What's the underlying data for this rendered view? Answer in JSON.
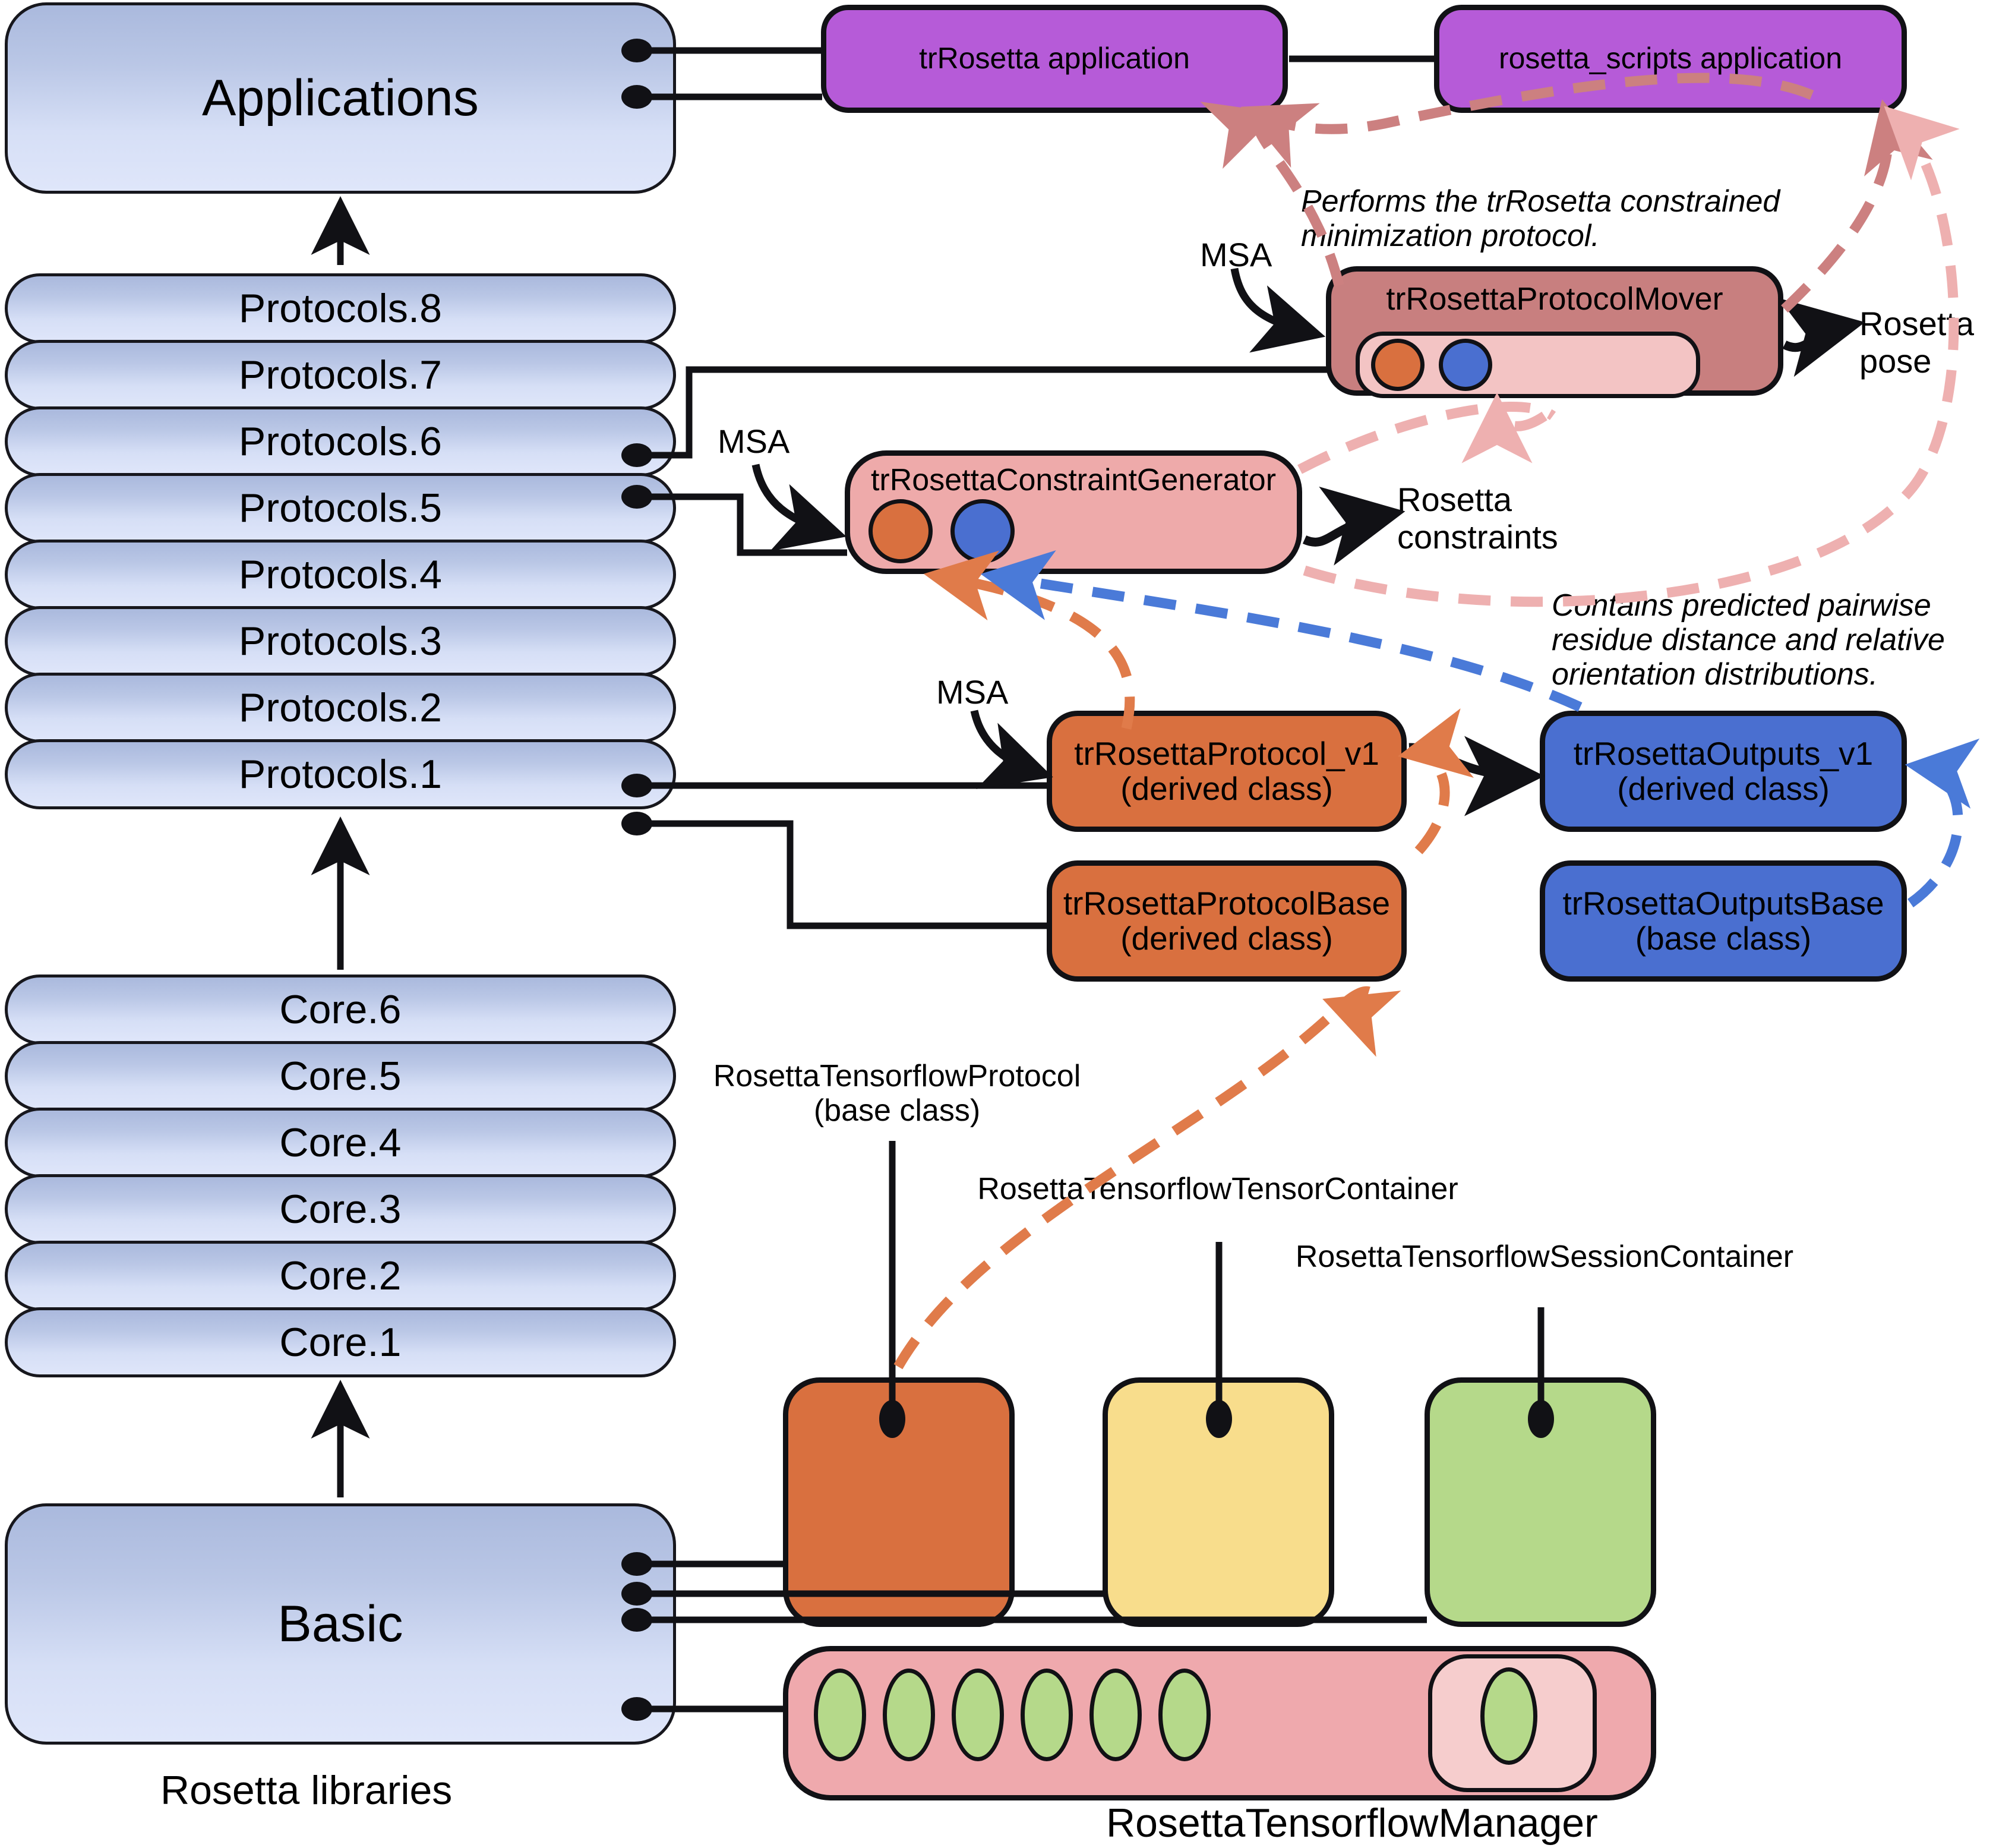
{
  "diagram": {
    "title_caption": "Rosetta libraries",
    "manager_caption": "RosettaTensorflowManager"
  },
  "libraries": {
    "applications": "Applications",
    "protocols": [
      "Protocols.8",
      "Protocols.7",
      "Protocols.6",
      "Protocols.5",
      "Protocols.4",
      "Protocols.3",
      "Protocols.2",
      "Protocols.1"
    ],
    "core": [
      "Core.6",
      "Core.5",
      "Core.4",
      "Core.3",
      "Core.2",
      "Core.1"
    ],
    "basic": "Basic"
  },
  "applications_row": {
    "trrosetta_app": "trRosetta application",
    "rosetta_scripts_app": "rosetta_scripts application"
  },
  "classes": {
    "mover": "trRosettaProtocolMover",
    "constraint_generator": "trRosettaConstraintGenerator",
    "protocol_v1": "trRosettaProtocol_v1\n(derived class)",
    "protocol_base": "trRosettaProtocolBase\n(derived class)",
    "outputs_v1": "trRosettaOutputs_v1\n(derived class)",
    "outputs_base": "trRosettaOutputsBase\n(base class)"
  },
  "tensorflow_labels": {
    "protocol": "RosettaTensorflowProtocol\n(base class)",
    "tensor_container": "RosettaTensorflowTensorContainer",
    "session_container": "RosettaTensorflowSessionContainer"
  },
  "annotations": {
    "mover_note": "Performs the trRosetta constrained\nminimization protocol.",
    "outputs_note": "Contains  predicted pairwise\nresidue distance and relative\norientation distributions.",
    "msa_mover": "MSA",
    "msa_cgen": "MSA",
    "msa_protocol": "MSA",
    "rosetta_pose": "Rosetta\npose",
    "rosetta_constraints": "Rosetta\nconstraints"
  },
  "colors": {
    "library_blue_top": "#aab9dd",
    "library_blue_bottom": "#dfe6fa",
    "application_purple": "#b65bd8",
    "mover_pink": "#c87f7f",
    "constraint_pink": "#eeaaaa",
    "protocol_orange": "#d9703f",
    "outputs_blue": "#4a6fd0",
    "tensor_yellow": "#f8dd8c",
    "session_green": "#b5d98a",
    "manager_pink": "#efa9ad",
    "dashed_pink": "#eeb0b0",
    "dashed_rose": "#cc8080",
    "dashed_orange": "#e07b4a",
    "dashed_blue": "#4a7ad8",
    "outline": "#111115"
  }
}
